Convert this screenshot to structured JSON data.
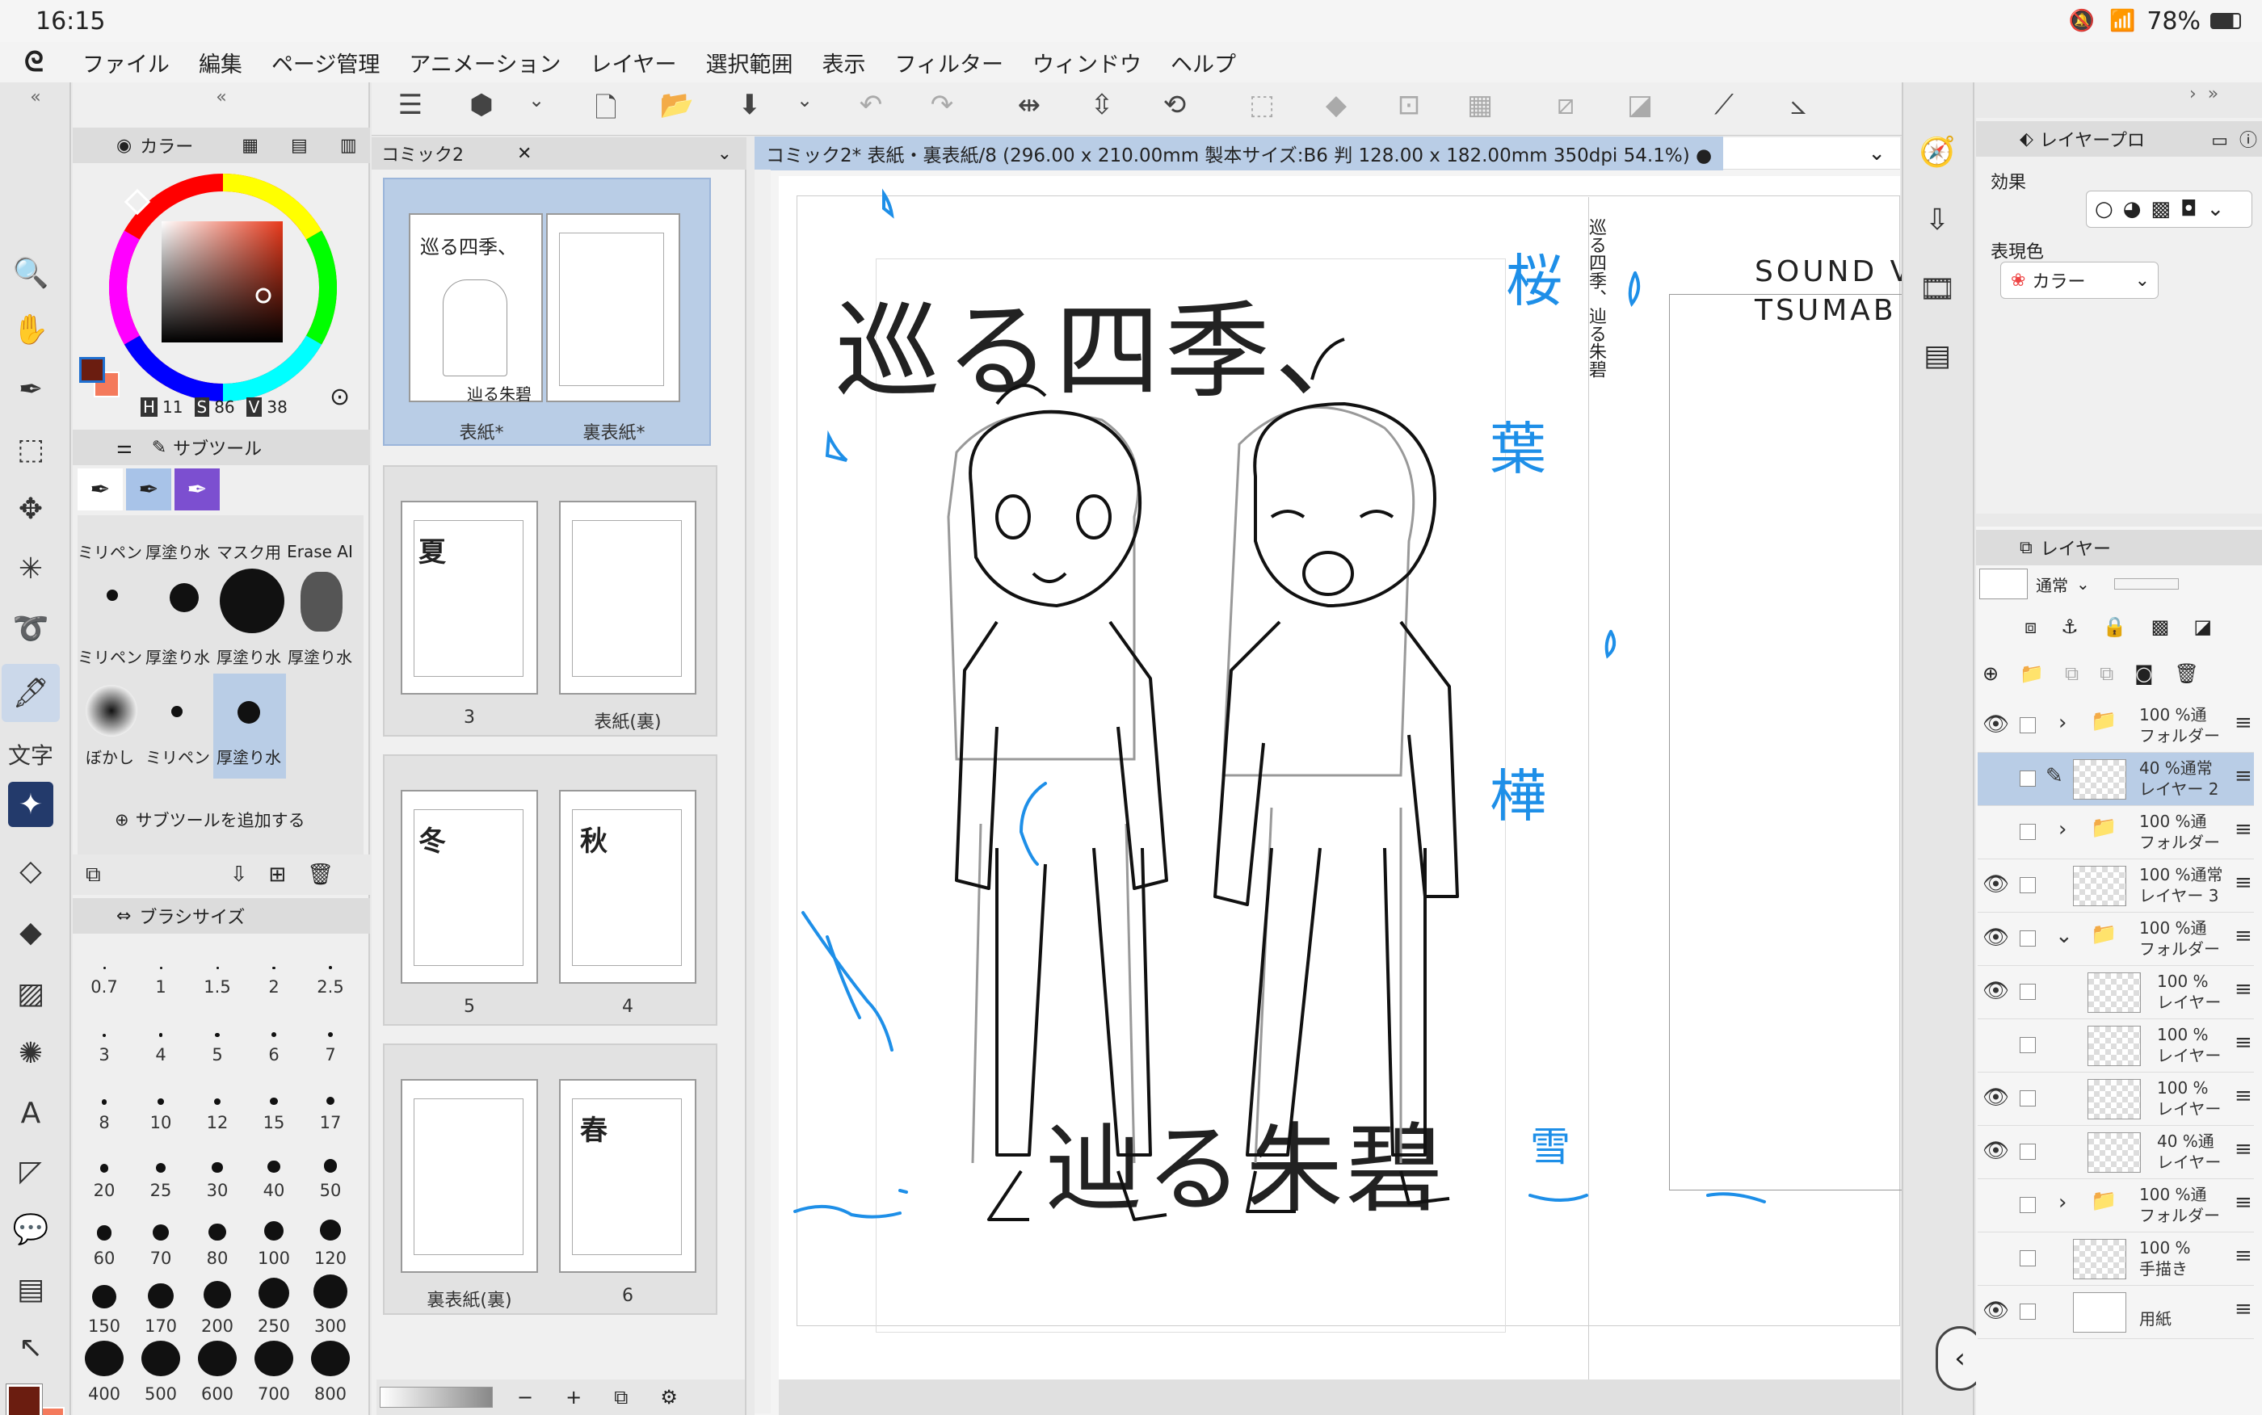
{
  "status": {
    "time": "16:15",
    "battery": "78%"
  },
  "menu": [
    "ファイル",
    "編集",
    "ページ管理",
    "アニメーション",
    "レイヤー",
    "選択範囲",
    "表示",
    "フィルター",
    "ウィンドウ",
    "ヘルプ"
  ],
  "color_panel": {
    "tab": "カラー",
    "h_label": "H",
    "h": "11",
    "s_label": "S",
    "s": "86",
    "v_label": "V",
    "v": "38",
    "main_color": "#6b1d10",
    "sub_color": "#f47a5c"
  },
  "subtool": {
    "tab": "サブツール",
    "row1": [
      "ミリペン",
      "厚塗り水",
      "マスク用",
      "Erase AI"
    ],
    "row2": [
      "ミリペン",
      "厚塗り水",
      "厚塗り水",
      "厚塗り水"
    ],
    "row3": [
      "ぼかし",
      "ミリペン",
      "厚塗り水"
    ],
    "add_label": "サブツールを追加する"
  },
  "brushsize": {
    "tab": "ブラシサイズ",
    "sizes": [
      "0.7",
      "1",
      "1.5",
      "2",
      "2.5",
      "3",
      "4",
      "5",
      "6",
      "7",
      "8",
      "10",
      "12",
      "15",
      "17",
      "20",
      "25",
      "30",
      "40",
      "50",
      "60",
      "70",
      "80",
      "100",
      "120",
      "150",
      "170",
      "200",
      "250",
      "300",
      "400",
      "500",
      "600",
      "700",
      "800"
    ]
  },
  "pages": {
    "tab": "コミック2",
    "spread_left": "表紙*",
    "spread_right": "裏表紙*",
    "p3": "3",
    "p_back_inner": "表紙(裏)",
    "p5": "5",
    "p4": "4",
    "p_back_back": "裏表紙(裏)",
    "p6": "6",
    "sum": "夏",
    "win": "冬",
    "aut": "秋",
    "spr": "春",
    "cover_title": "巡る四季、",
    "cover_sub": "辿る朱碧"
  },
  "canvas": {
    "tab": "コミック2* 表紙・裏表紙/8 (296.00 x 210.00mm 製本サイズ:B6 判 128.00 x 182.00mm 350dpi 54.1%)",
    "title_top": "巡る四季、",
    "title_bottom": "辿る朱碧",
    "vertical": "巡る四季、辿る朱碧",
    "sound1": "SOUND VO",
    "sound2": "TSUMAB",
    "kanji": [
      "桜",
      "葉",
      "樺",
      "雪"
    ]
  },
  "layer_property": {
    "tab": "レイヤープロ",
    "effect_label": "効果",
    "color_label": "表現色",
    "color_value": "カラー"
  },
  "layers": {
    "tab": "レイヤー",
    "blend": "通常",
    "rows": [
      {
        "pct": "100 %通",
        "name": "フォルダー"
      },
      {
        "pct": "40 %通常",
        "name": "レイヤー 2"
      },
      {
        "pct": "100 %通",
        "name": "フォルダー"
      },
      {
        "pct": "100 %通常",
        "name": "レイヤー 3"
      },
      {
        "pct": "100 %通",
        "name": "フォルダー"
      },
      {
        "pct": "100 %",
        "name": "レイヤー"
      },
      {
        "pct": "100 %",
        "name": "レイヤー"
      },
      {
        "pct": "100 %",
        "name": "レイヤー"
      },
      {
        "pct": "40 %通",
        "name": "レイヤー"
      },
      {
        "pct": "100 %通",
        "name": "フォルダー"
      },
      {
        "pct": "100 %",
        "name": "手描き"
      },
      {
        "pct": "",
        "name": "用紙"
      }
    ]
  }
}
